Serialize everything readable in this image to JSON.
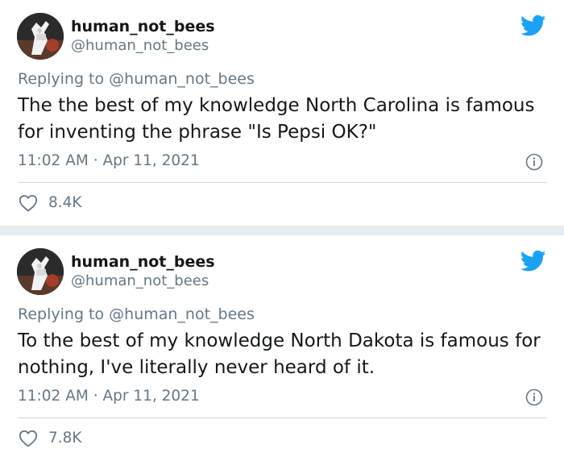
{
  "tweets": [
    {
      "display_name": "human_not_bees",
      "handle": "@human_not_bees",
      "replying_prefix": "Replying to ",
      "replying_to": "@human_not_bees",
      "text": "The the best of my knowledge North Carolina is famous for inventing the phrase \"Is Pepsi OK?\"",
      "timestamp": "11:02 AM · Apr 11, 2021",
      "likes": "8.4K"
    },
    {
      "display_name": "human_not_bees",
      "handle": "@human_not_bees",
      "replying_prefix": "Replying to ",
      "replying_to": "@human_not_bees",
      "text": "To the best of my knowledge North Dakota is famous for nothing, I've literally never heard of it.",
      "timestamp": "11:02 AM · Apr 11, 2021",
      "likes": "7.8K"
    }
  ],
  "colors": {
    "twitter_blue": "#1da1f2",
    "secondary_text": "#657786",
    "primary_text": "#14171a",
    "divider": "#ccd6dd",
    "separator_background": "#e6ecf0"
  },
  "icons": {
    "brand": "twitter-bird-icon",
    "info": "info-icon",
    "like": "heart-icon",
    "avatar": "avatar"
  }
}
